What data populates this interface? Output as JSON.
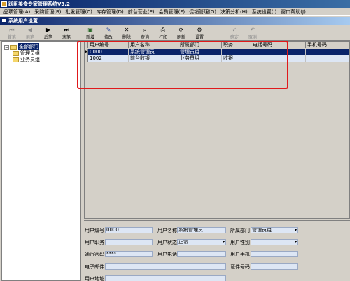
{
  "app": {
    "title": "跃臣美食专家管理系统V3.2"
  },
  "menu": [
    {
      "label": "品项管理",
      "hotkey": "(A)"
    },
    {
      "label": "采购管理",
      "hotkey": "(B)"
    },
    {
      "label": "批发管理",
      "hotkey": "(C)"
    },
    {
      "label": "库存管理",
      "hotkey": "(D)"
    },
    {
      "label": "前台营业",
      "hotkey": "(E)"
    },
    {
      "label": "会员管理",
      "hotkey": "(F)"
    },
    {
      "label": "促销管理",
      "hotkey": "(G)"
    },
    {
      "label": "决策分析",
      "hotkey": "(H)"
    },
    {
      "label": "系统设置",
      "hotkey": "(I)"
    },
    {
      "label": "窗口帮助",
      "hotkey": "(J)"
    }
  ],
  "window": {
    "title": "系统用户设置"
  },
  "toolbar": {
    "first": "首笔",
    "prev": "前笔",
    "next": "后笔",
    "last": "末笔",
    "add": "新增",
    "edit": "修改",
    "delete": "删除",
    "query": "查询",
    "print": "打印",
    "refresh": "刷新",
    "settings": "设置",
    "confirm": "确定",
    "cancel": "取消"
  },
  "tree": {
    "root": "全部部门",
    "children": [
      "管理员组",
      "业务员组"
    ]
  },
  "grid": {
    "columns": [
      "用户编号",
      "用户名称",
      "所属部门",
      "职务",
      "电话号码",
      "手机号码"
    ],
    "rows": [
      {
        "id": "0000",
        "name": "系统管理员",
        "dept": "管理员组",
        "title": "",
        "phone": "",
        "mobile": ""
      },
      {
        "id": "1002",
        "name": "前台收银",
        "dept": "业务员组",
        "title": "收银",
        "phone": "",
        "mobile": ""
      }
    ],
    "selected_row": 0
  },
  "form": {
    "user_id_label": "用户编号",
    "user_id": "0000",
    "user_name_label": "用户名称",
    "user_name": "系统管理员",
    "dept_label": "所属部门",
    "dept": "管理员组",
    "position_label": "用户职务",
    "position": "",
    "status_label": "用户状态",
    "status": "正常",
    "gender_label": "用户性别",
    "gender": "",
    "password_label": "通行密码",
    "password": "****",
    "phone_label": "用户电话",
    "phone": "",
    "mobile_label": "用户手机",
    "mobile": "",
    "email_label": "电子邮件",
    "email": "",
    "idcard_label": "证件号码",
    "idcard": "",
    "address_label": "用户地址",
    "address": ""
  },
  "colors": {
    "title_bar": "#0a246a",
    "annotation": "#e0191b",
    "selected_row": "#0a246a",
    "row_bg": "#dde6f4"
  }
}
